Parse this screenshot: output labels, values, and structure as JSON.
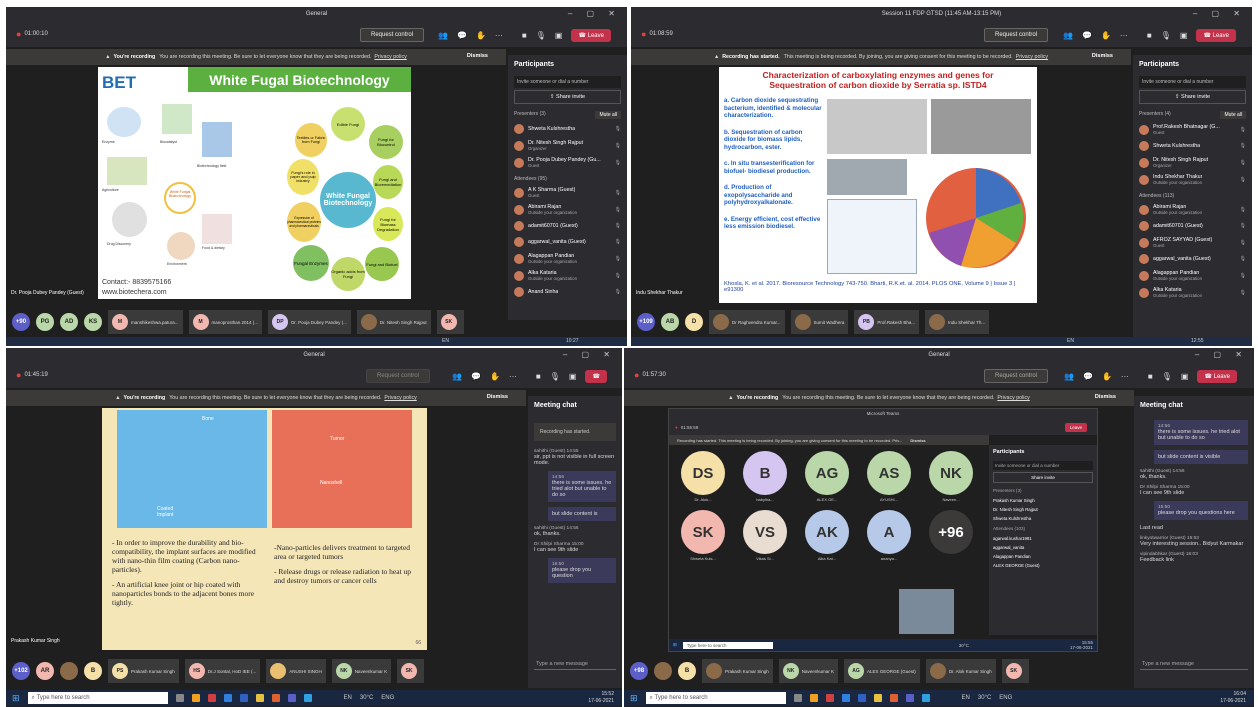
{
  "q1": {
    "title": "General",
    "timer": "01:00:10",
    "req": "Request control",
    "leave": "Leave",
    "banner_bold": "You're recording",
    "banner": "You are recording this meeting. Be sure to let everyone know that they are being recorded.",
    "privacy": "Privacy policy",
    "dismiss": "Dismiss",
    "participants": "Participants",
    "invite": "Invite someone or dial a number",
    "share": "Share invite",
    "presenters": "Presenters (3)",
    "muteall": "Mute all",
    "pres": [
      {
        "n": "Shweta Kulshrestha",
        "s": ""
      },
      {
        "n": "Dr. Nitesh Singh Rajput",
        "s": "Organizer"
      },
      {
        "n": "Dr. Pooja Dubey Pandey (Gu...",
        "s": "Guest"
      }
    ],
    "attendees": "Attendees (95)",
    "att": [
      {
        "n": "A K Sharma (Guest)",
        "s": "Guest"
      },
      {
        "n": "Abirami Rajan",
        "s": "Outside your organization"
      },
      {
        "n": "adamit60701 (Guest)",
        "s": ""
      },
      {
        "n": "aggarwal_vanita (Guest)",
        "s": ""
      },
      {
        "n": "Alagappan Pandian",
        "s": "Outside your organization"
      },
      {
        "n": "Alka Kataria",
        "s": "Outside your organization"
      },
      {
        "n": "Anand Sinha",
        "s": ""
      }
    ],
    "slide_title": "White Fugal Biotechnology",
    "logo": "BET",
    "center": "White Fungal Biotechnology",
    "petals": [
      "Edible Fungi",
      "Fungi for Biocontrol",
      "Fungi and Bioremediation",
      "Fungi for Biomass Degradation",
      "Fungi and Biofuel",
      "Organic acids from Fungi",
      "Fungal Enzymes",
      "Expression of pharmaceutical proteins and pharmaceuticals",
      "Fungi's role in paper and pulp industry",
      "Textiles or Fabric from Fungi"
    ],
    "left_labels": [
      "Enzyme",
      "Biocatalyst",
      "Agriculture",
      "Biotechnology field",
      "Drug Discovery",
      "White Fungal Biotechnology",
      "Environment",
      "Food & dietary"
    ],
    "contact": "Contact:- 8839575166",
    "web": "www.biotechera.com",
    "presenter": "Dr. Pooja Dubey Pandey (Guest)",
    "tray": [
      {
        "i": "+90",
        "c": "#5b5fc7"
      },
      {
        "i": "PG",
        "c": "#b9d7a8"
      },
      {
        "i": "AD",
        "c": "#b9d7a8"
      },
      {
        "i": "KS",
        "c": "#b9d7a8"
      }
    ],
    "tiles": [
      {
        "i": "M",
        "n": "manshikeshwa.patura...",
        "c": "#f2b8b0"
      },
      {
        "i": "M",
        "n": "manoprosthan.2014 (...",
        "c": "#f2b8b0"
      },
      {
        "i": "DP",
        "n": "Dr. Pooja Dubey Pandey (...",
        "c": "#d4c6f0"
      },
      {
        "i": "",
        "n": "Dr. Nitesh Singh Rajput",
        "c": "#8b6a4a"
      },
      {
        "i": "SK",
        "n": "",
        "c": "#f2b8b0"
      }
    ],
    "lang": "EN",
    "clock": "10:27"
  },
  "q2": {
    "title": "Session 11 FDP GTSD (11:45 AM-13:15 PM)",
    "timer": "01:08:59",
    "req": "Request control",
    "leave": "Leave",
    "banner_bold": "Recording has started.",
    "banner": "This meeting is being recorded. By joining, you are giving consent for this meeting to be recorded.",
    "privacy": "Privacy policy",
    "dismiss": "Dismiss",
    "participants": "Participants",
    "invite": "Invite someone or dial a number",
    "share": "Share invite",
    "presenters": "Presenters (4)",
    "muteall": "Mute all",
    "pres": [
      {
        "n": "Prof.Rakesh Bhatnagar (G...",
        "s": "Guest"
      },
      {
        "n": "Shweta Kulshrestha",
        "s": ""
      },
      {
        "n": "Dr. Nitesh Singh Rajput",
        "s": "Organizer"
      },
      {
        "n": "Indu Shekhar Thakur",
        "s": "Outside your organization"
      }
    ],
    "attendees": "Attendees (113)",
    "att": [
      {
        "n": "Abirami Rajan",
        "s": "Outside your organization"
      },
      {
        "n": "adamit60701 (Guest)",
        "s": ""
      },
      {
        "n": "AFROZ SAYYAD (Guest)",
        "s": "Guest"
      },
      {
        "n": "aggarwal_vanita (Guest)",
        "s": ""
      },
      {
        "n": "Alagappan Pandian",
        "s": "Outside your organization"
      },
      {
        "n": "Alka Kataria",
        "s": "Outside your organization"
      }
    ],
    "slide_title1": "Characterization of carboxylating enzymes and genes for",
    "slide_title2": "Sequestration of carbon dioxide by Serratia sp. ISTD4",
    "points": [
      "a. Carbon dioxide sequestrating bacterium, identified & molecular characterization.",
      "b. Sequestration of carbon dioxide for biomass lipids, hydrocarbon, ester.",
      "c. In situ transesterification for biofuel- biodiesel production.",
      "d. Production of exopolysaccharide and polyhydroxyalkalonate.",
      "e. Energy efficient, cost effective less emission biodiesel."
    ],
    "ref": "Khosla, K. et al. 2017. Bioresource Technology 743-750.   Bharti, R.K.et. al. 2014. PLOS ONE, Volume 9 | Issue 3 | e91300",
    "presenter": "Indu Shekhar Thakur",
    "tray": [
      {
        "i": "+109",
        "c": "#5b5fc7"
      },
      {
        "i": "AB",
        "c": "#b9d7a8"
      },
      {
        "i": "D",
        "c": "#f5e0a8"
      }
    ],
    "tiles": [
      {
        "i": "",
        "n": "Dr Raghvendra Kumar...",
        "c": "#8b6a4a"
      },
      {
        "i": "",
        "n": "Sumit Wadhera",
        "c": "#8b6a4a"
      },
      {
        "i": "PB",
        "n": "Prof.Rakesh Bha...",
        "c": "#d4c6f0"
      },
      {
        "i": "",
        "n": "Indu Shekhar Th...",
        "c": "#8b6a4a"
      }
    ],
    "lang": "EN",
    "clock": "12:55"
  },
  "q3": {
    "title": "General",
    "timer": "01:45:19",
    "req": "Request control",
    "banner_bold": "You're recording",
    "banner": "You are recording this meeting. Be sure to let everyone know that they are being recorded.",
    "privacy": "Privacy policy",
    "dismiss": "Dismiss",
    "chat_title": "Meeting chat",
    "chat_rec": "Recording has started.",
    "chat": [
      {
        "nm": "sahithi (Guest)  14:55",
        "t": "sir, ppt is not visible in full screen mode.",
        "own": false
      },
      {
        "nm": "14:56",
        "t": "there is some issues. he tried alot but unable to do so",
        "own": true
      },
      {
        "nm": "",
        "t": "but slide content is",
        "own": true
      },
      {
        "nm": "sahithi (Guest)  14:56",
        "t": "ok, thanks.",
        "own": false
      },
      {
        "nm": "Dr Shilpi Sharma  15:00",
        "t": "I can see 9th slide",
        "own": false
      },
      {
        "nm": "15:50",
        "t": "please drop you question",
        "own": true
      }
    ],
    "chat_input": "Type a new message",
    "img_labels": [
      "Bone",
      "Coated Implant",
      "Tumor",
      "Nanoshell"
    ],
    "left_bullets": [
      "- In order to improve the durability and bio-compatibility, the implant surfaces are modified with nano-thin film coating (Carbon nano-particles).",
      "- An artificial knee joint or hip coated with nanoparticles bonds to the adjacent bones more tightly."
    ],
    "right_bullets": [
      "-Nano-particles delivers treatment to targeted area or targeted tumors",
      "- Release drugs or release radiation to heat up and destroy tumors or cancer cells"
    ],
    "page": "66",
    "presenter": "Prakash Kumar Singh",
    "tray": [
      {
        "i": "+102",
        "c": "#5b5fc7"
      },
      {
        "i": "AR",
        "c": "#f2b8b0"
      },
      {
        "i": "",
        "c": "#8b6a4a"
      },
      {
        "i": "B",
        "c": "#f5e0a8"
      }
    ],
    "tiles": [
      {
        "i": "PS",
        "n": "Prakash Kumar Singh",
        "c": "#f5e0a8"
      },
      {
        "i": "HS",
        "n": "Dr.J Sontal, HoD IEE (...",
        "c": "#f2b8b0"
      },
      {
        "i": "",
        "n": "ANUSHI SINGH",
        "c": "#e8c070"
      },
      {
        "i": "NK",
        "n": "Naveenkumar K",
        "c": "#b9d7a8"
      },
      {
        "i": "SK",
        "n": "",
        "c": "#f2b8b0"
      }
    ],
    "search": "Type here to search",
    "lang": "EN",
    "temp": "30°C",
    "eng": "ENG",
    "clock1": "15:52",
    "clock2": "17-06-2021"
  },
  "q4": {
    "title": "General",
    "timer": "01:57:30",
    "req": "Request control",
    "leave": "Leave",
    "banner_bold": "You're recording",
    "banner": "You are recording this meeting. Be sure to let everyone know that they are being recorded.",
    "privacy": "Privacy policy",
    "dismiss": "Dismiss",
    "inner_title": "Microsoft Teams",
    "inner_timer": "01:55:59",
    "inner_leave": "Leave",
    "inner_banner": "Recording has started.  This meeting is being recorded. By joining, you are giving consent for this meeting to be recorded. Priv...",
    "inner_dismiss": "Dismiss",
    "inner_participants": "Participants",
    "inner_invite": "Invite someone or dial a number",
    "inner_share": "Share invite",
    "inner_pres": "Presenters (3)",
    "inner_pres_list": [
      "Prakash Kumar Singh",
      "Dr. Nitesh Singh Rajput",
      "Shweta Kulshrestha"
    ],
    "inner_att": "Attendees (103)",
    "inner_att_list": [
      "agarwal.kushar1991",
      "aggarwal_vanita",
      "Alagappan Pandian",
      "ALEX GEORGE (Guest)"
    ],
    "grid": [
      {
        "i": "DS",
        "n": "Dr. Alok...",
        "c": "#f5e0a8"
      },
      {
        "i": "B",
        "n": "babylha...",
        "c": "#d4c6f0"
      },
      {
        "i": "AG",
        "n": "ALEX GE...",
        "c": "#b9d7a8"
      },
      {
        "i": "AS",
        "n": "AYUSHI...",
        "c": "#b9d7a8"
      },
      {
        "i": "NK",
        "n": "Naveen...",
        "c": "#b9d7a8"
      },
      {
        "i": "SK",
        "n": "Shweta Kuls...",
        "c": "#f2b8b0"
      },
      {
        "i": "VS",
        "n": "Vikas Si...",
        "c": "#e8ddd0"
      },
      {
        "i": "AK",
        "n": "Alka Kat...",
        "c": "#b7c9e8"
      },
      {
        "i": "A",
        "n": "ananya...",
        "c": "#b7c9e8"
      },
      {
        "i": "+96",
        "n": "",
        "c": "#3b3a39"
      }
    ],
    "inner_search": "Type here to search",
    "inner_temp": "30°C",
    "inner_clock": "15:55",
    "inner_date": "17-06-2021",
    "chat_title": "Meeting chat",
    "chat": [
      {
        "nm": "14:56",
        "t": "there is some issues. he tried alot but unable to do so",
        "own": true
      },
      {
        "nm": "",
        "t": "but slide content is visible",
        "own": true
      },
      {
        "nm": "sahithi (Guest)  14:56",
        "t": "ok, thanks.",
        "own": false
      },
      {
        "nm": "Dr Shilpi Sharma  15:00",
        "t": "I can see 9th slide",
        "own": false
      },
      {
        "nm": "15:50",
        "t": "please drop you questions here",
        "own": true
      },
      {
        "nm": "",
        "t": "Last read",
        "own": false
      },
      {
        "nm": "linkyotwarrior (Guest)  15:53",
        "t": "Very interesting session.. Bidyut Karmakar",
        "own": false
      },
      {
        "nm": "vipindabhkar (Guest)  16:03",
        "t": "Feedback link",
        "own": false
      }
    ],
    "chat_input": "Type a new message",
    "tray": [
      {
        "i": "+98",
        "c": "#5b5fc7"
      },
      {
        "i": "",
        "c": "#8b6a4a"
      },
      {
        "i": "B",
        "c": "#f5e0a8"
      }
    ],
    "tiles": [
      {
        "i": "",
        "n": "Prakash Kumar Singh",
        "c": "#8b6a4a"
      },
      {
        "i": "NK",
        "n": "Naveenkumar K",
        "c": "#b9d7a8"
      },
      {
        "i": "AG",
        "n": "ALEX GEORGE (Guest)",
        "c": "#b9d7a8"
      },
      {
        "i": "",
        "n": "Dr. Alok Kumar Singh",
        "c": "#8b6a4a"
      },
      {
        "i": "SK",
        "n": "",
        "c": "#f2b8b0"
      }
    ],
    "search": "Type here to search",
    "lang": "EN",
    "temp": "30°C",
    "eng": "ENG",
    "clock1": "16:04",
    "clock2": "17-06-2021"
  }
}
